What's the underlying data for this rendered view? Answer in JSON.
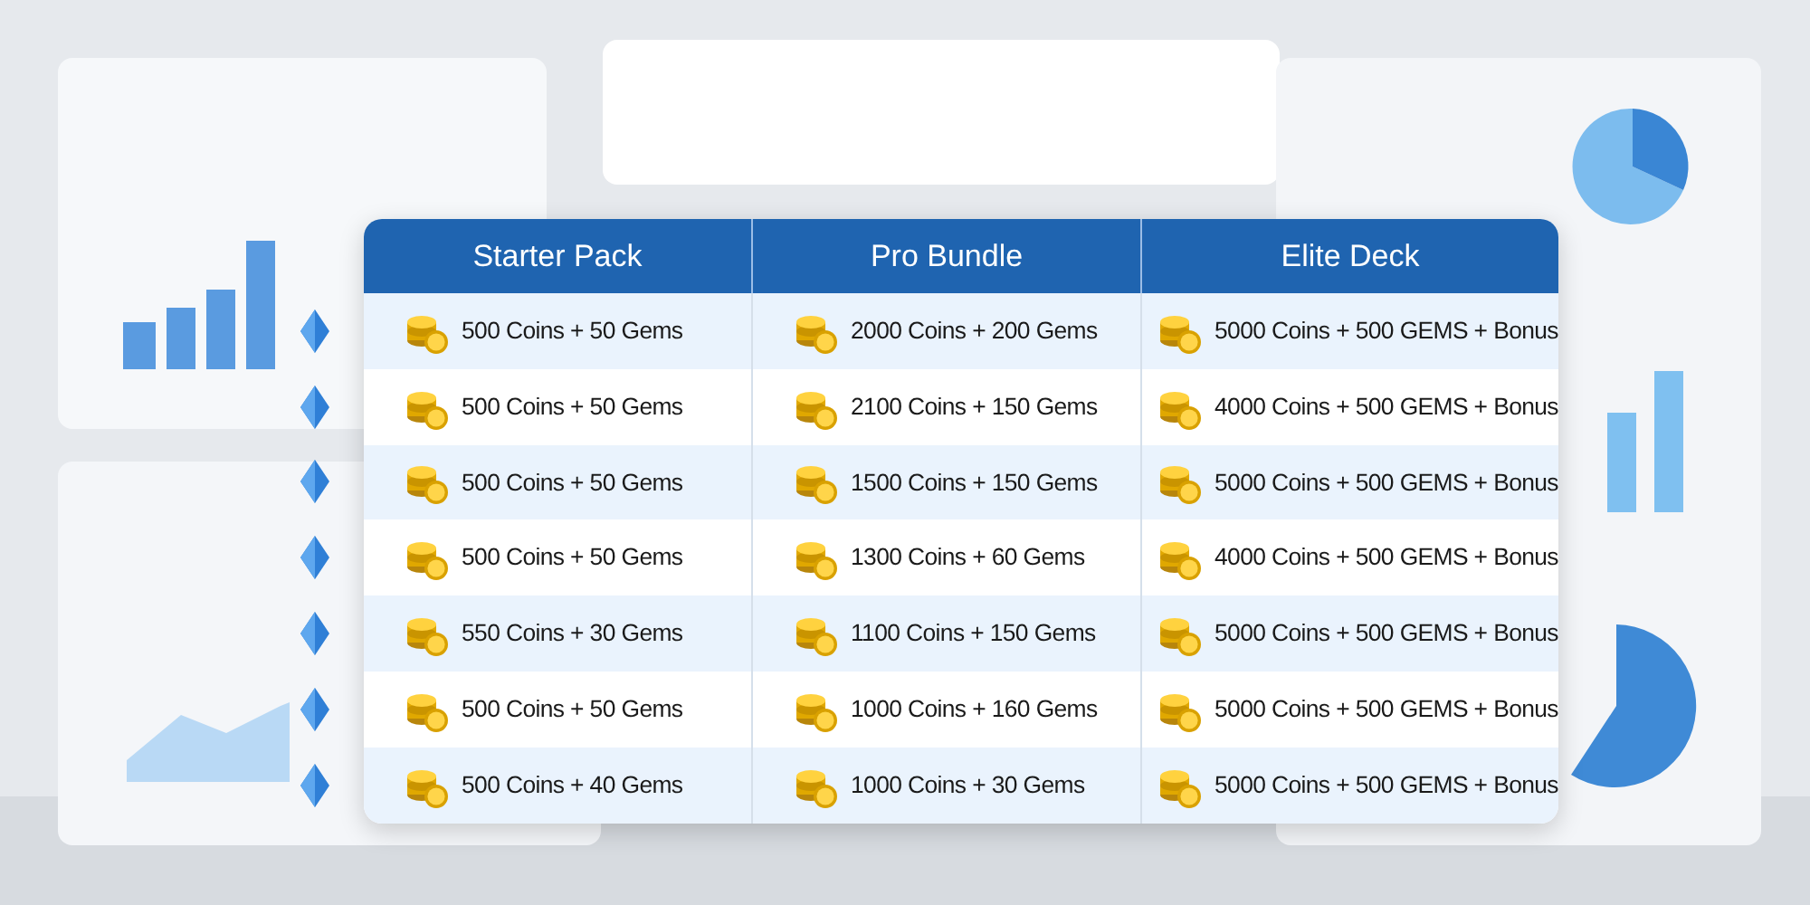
{
  "table": {
    "columns": [
      "Starter Pack",
      "Pro Bundle",
      "Elite Deck"
    ],
    "rows": [
      {
        "cells": [
          "500 Coins + 50 Gems",
          "2000 Coins + 200 Gems",
          "5000 Coins + 500 GEMS + Bonus"
        ]
      },
      {
        "cells": [
          "500 Coins + 50 Gems",
          "2100 Coins + 150 Gems",
          "4000 Coins + 500 GEMS + Bonus"
        ]
      },
      {
        "cells": [
          "500 Coins + 50 Gems",
          "1500 Coins + 150 Gems",
          "5000 Coins + 500 GEMS + Bonus"
        ]
      },
      {
        "cells": [
          "500 Coins + 50 Gems",
          "1300 Coins + 60 Gems",
          "4000 Coins + 500 GEMS + Bonus"
        ]
      },
      {
        "cells": [
          "550 Coins + 30 Gems",
          "1100 Coins + 150 Gems",
          "5000 Coins + 500 GEMS + Bonus"
        ]
      },
      {
        "cells": [
          "500 Coins + 50 Gems",
          "1000 Coins + 160 Gems",
          "5000 Coins + 500 GEMS + Bonus"
        ]
      },
      {
        "cells": [
          "500 Coins + 40 Gems",
          "1000 Coins + 30 Gems",
          "5000 Coins + 500 GEMS + Bonus"
        ]
      }
    ]
  }
}
